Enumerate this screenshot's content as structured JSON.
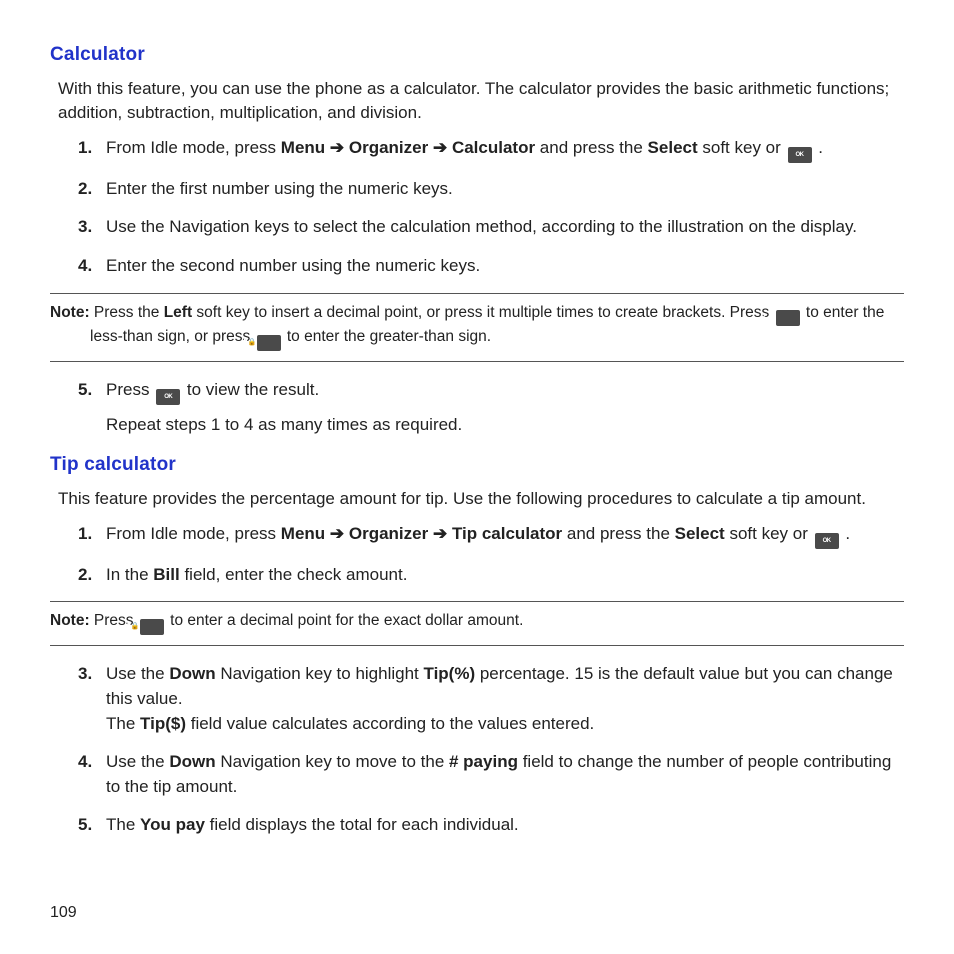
{
  "section1": {
    "heading": "Calculator",
    "intro": "With this feature, you can use the phone as a calculator. The calculator provides the basic arithmetic functions; addition, subtraction, multiplication, and division.",
    "steps": {
      "s1_pre": "From Idle mode, press ",
      "s1_menu": "Menu",
      "s1_org": "Organizer",
      "s1_calc": "Calculator",
      "s1_mid": " and press the ",
      "s1_select": "Select",
      "s1_post": " soft key or ",
      "s2": "Enter the first number using the numeric keys.",
      "s3": "Use the Navigation keys to select the calculation method, according to the illustration on the display.",
      "s4": "Enter the second number using the numeric keys.",
      "s5_pre": "Press ",
      "s5_post": " to view the result.",
      "s5_sub": "Repeat steps 1 to 4 as many times as required."
    },
    "note": {
      "label": "Note:",
      "t1": " Press the ",
      "left": "Left",
      "t2": " soft key to insert a decimal point, or press it multiple times to create brackets. Press ",
      "t3": " to enter the less-than sign, or press ",
      "t4": " to enter the greater-than sign."
    }
  },
  "section2": {
    "heading": "Tip calculator",
    "intro": "This feature provides the percentage amount for tip. Use the following procedures to calculate a tip amount.",
    "steps": {
      "s1_pre": "From Idle mode, press ",
      "s1_menu": "Menu",
      "s1_org": "Organizer",
      "s1_tip": "Tip calculator",
      "s1_mid": " and press the ",
      "s1_select": "Select",
      "s1_post": " soft key or ",
      "s2_pre": "In the ",
      "s2_bill": "Bill",
      "s2_post": " field, enter the check amount.",
      "s3_pre": "Use the ",
      "s3_down": "Down",
      "s3_mid": " Navigation key to highlight ",
      "s3_tippc": "Tip(%)",
      "s3_post1": " percentage. 15 is the default value but you can change this value.",
      "s3_line2a": "The ",
      "s3_tipd": "Tip($)",
      "s3_line2b": " field value calculates according to the values entered.",
      "s4_pre": "Use the ",
      "s4_down": "Down",
      "s4_mid": " Navigation key to move to the ",
      "s4_pay": "# paying",
      "s4_post": " field to change the number of people contributing to the tip amount.",
      "s5_pre": "The ",
      "s5_you": "You pay",
      "s5_post": " field displays the total for each individual."
    },
    "note": {
      "label": "Note:",
      "t1": " Press ",
      "t2": " to enter a decimal point for the exact dollar amount."
    }
  },
  "nums": {
    "n1": "1.",
    "n2": "2.",
    "n3": "3.",
    "n4": "4.",
    "n5": "5."
  },
  "arrow": " ➔ ",
  "page": "109"
}
